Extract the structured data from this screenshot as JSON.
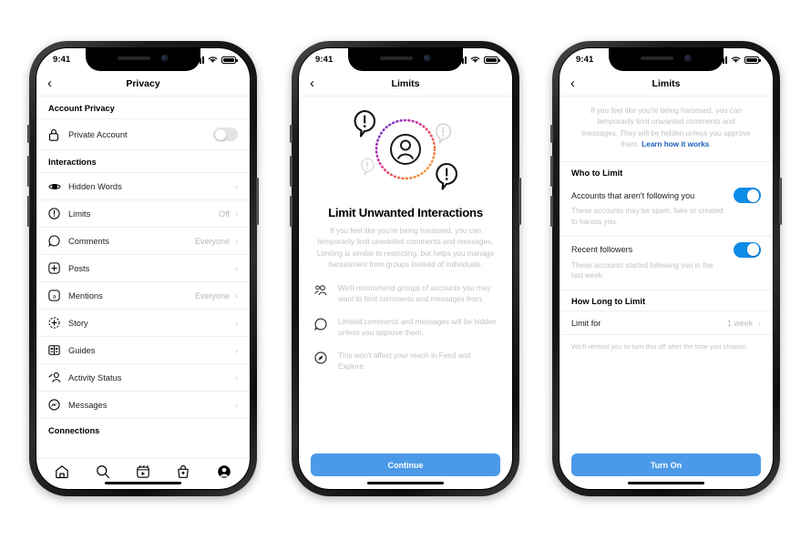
{
  "status_bar": {
    "time": "9:41"
  },
  "colors": {
    "accent_blue": "#0095f6",
    "cta_blue": "#4a9ae8",
    "toggle_on": "#0d8ce8",
    "link_blue": "#1c5db5"
  },
  "phone1": {
    "nav": {
      "back": "‹",
      "title": "Privacy"
    },
    "sections": [
      {
        "header": "Account Privacy"
      },
      {
        "header": "Interactions"
      },
      {
        "header": "Connections"
      }
    ],
    "account_privacy": {
      "header": "Account Privacy",
      "rows": [
        {
          "icon": "lock-icon",
          "label": "Private Account",
          "control": "toggle",
          "on": false
        }
      ]
    },
    "interactions": {
      "header": "Interactions",
      "rows": [
        {
          "icon": "hidden-words-icon",
          "label": "Hidden Words",
          "value": "",
          "chevron": "›"
        },
        {
          "icon": "limits-icon",
          "label": "Limits",
          "value": "Off",
          "chevron": "›"
        },
        {
          "icon": "comments-icon",
          "label": "Comments",
          "value": "Everyone",
          "chevron": "›"
        },
        {
          "icon": "posts-icon",
          "label": "Posts",
          "value": "",
          "chevron": "›"
        },
        {
          "icon": "mentions-icon",
          "label": "Mentions",
          "value": "Everyone",
          "chevron": "›"
        },
        {
          "icon": "story-icon",
          "label": "Story",
          "value": "",
          "chevron": "›"
        },
        {
          "icon": "guides-icon",
          "label": "Guides",
          "value": "",
          "chevron": "›"
        },
        {
          "icon": "activity-status-icon",
          "label": "Activity Status",
          "value": "",
          "chevron": "›"
        },
        {
          "icon": "messages-icon",
          "label": "Messages",
          "value": "",
          "chevron": "›"
        }
      ]
    },
    "connections": {
      "header": "Connections"
    },
    "tabbar": [
      {
        "name": "home-icon"
      },
      {
        "name": "search-icon"
      },
      {
        "name": "reels-icon"
      },
      {
        "name": "shop-icon"
      },
      {
        "name": "profile-icon"
      }
    ]
  },
  "phone2": {
    "nav": {
      "back": "‹",
      "title": "Limits"
    },
    "title": "Limit Unwanted Interactions",
    "description": "If you feel like you're being harassed, you can temporarily limit unwanted comments and messages. Limiting is similar to restricting, but helps you manage harassment from groups instead of individuals.",
    "bullets": [
      {
        "icon": "group-accounts-icon",
        "text": "We'll recommend groups of accounts you may want to limit comments and messages from."
      },
      {
        "icon": "comment-bubble-icon",
        "text": "Limited comments and messages will be hidden unless you approve them."
      },
      {
        "icon": "compass-icon",
        "text": "This won't affect your reach in Feed and Explore."
      }
    ],
    "cta": "Continue"
  },
  "phone3": {
    "nav": {
      "back": "‹",
      "title": "Limits"
    },
    "intro": "If you feel like you're being harassed, you can temporarily limit unwanted comments and messages. They will be hidden unless you approve them.",
    "intro_link": "Learn how it works",
    "intro_link_suffix": ".",
    "who_header": "Who to Limit",
    "options": [
      {
        "title": "Accounts that aren't following you",
        "subtitle": "These accounts may be spam, fake or created to harass you.",
        "on": true
      },
      {
        "title": "Recent followers",
        "subtitle": "These accounts started following you in the last week.",
        "on": true
      }
    ],
    "howlong_header": "How Long to Limit",
    "limit_for": {
      "label": "Limit for",
      "value": "1 week",
      "chevron": "›"
    },
    "note": "We'll remind you to turn this off after the time you choose.",
    "cta": "Turn On"
  }
}
